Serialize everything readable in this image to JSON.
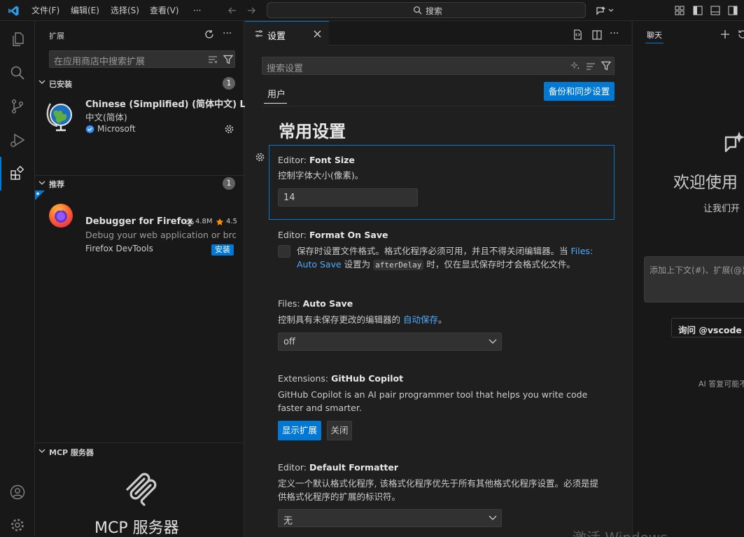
{
  "titlebar": {
    "menus": [
      "文件(F)",
      "编辑(E)",
      "选择(S)",
      "查看(V)",
      "···"
    ],
    "search_label": "搜索"
  },
  "sidebar": {
    "title": "扩展",
    "search_placeholder": "在应用商店中搜索扩展",
    "installed": {
      "header": "已安装",
      "count": "1",
      "items": [
        {
          "name": "Chinese (Simplified) (简体中文) L...",
          "desc": "中文(简体)",
          "publisher": "Microsoft"
        }
      ]
    },
    "recommended": {
      "header": "推荐",
      "count": "1",
      "items": [
        {
          "name": "Debugger for Firefox",
          "downloads": "4.8M",
          "rating": "4.5",
          "desc": "Debug your web application or bro...",
          "publisher": "Firefox DevTools",
          "install_label": "安装"
        }
      ]
    },
    "mcp": {
      "header": "MCP 服务器",
      "title": "MCP 服务器"
    }
  },
  "editor": {
    "tab_label": "设置",
    "search_placeholder": "搜索设置",
    "scope_tab": "用户",
    "backup_button": "备份和同步设置",
    "heading": "常用设置",
    "settings": {
      "font_size": {
        "category": "Editor: ",
        "name": "Font Size",
        "desc": "控制字体大小(像素)。",
        "value": "14"
      },
      "format_on_save": {
        "category": "Editor: ",
        "name": "Format On Save",
        "desc_a": "保存时设置文件格式。格式化程序必须可用，并且不得关闭编辑器。当 ",
        "link": "Files: Auto Save",
        "desc_b": " 设置为 ",
        "code": "afterDelay",
        "desc_c": " 时，仅在显式保存时才会格式化文件。"
      },
      "auto_save": {
        "category": "Files: ",
        "name": "Auto Save",
        "desc_a": "控制具有未保存更改的编辑器的 ",
        "link": "自动保存",
        "desc_b": "。",
        "value": "off"
      },
      "copilot": {
        "category": "Extensions: ",
        "name": "GitHub Copilot",
        "desc": "GitHub Copilot is an AI pair programmer tool that helps you write code faster and smarter.",
        "show_button": "显示扩展",
        "close_button": "关闭"
      },
      "default_formatter": {
        "category": "Editor: ",
        "name": "Default Formatter",
        "desc": "定义一个默认格式化程序, 该格式化程序优先于所有其他格式化程序设置。必须是提供格式化程序的扩展的标识符。",
        "value": "无"
      }
    }
  },
  "chat": {
    "tab_label": "聊天",
    "welcome": "欢迎使用",
    "subtitle": "让我们开",
    "input_placeholder": "添加上下文(#)、扩展(@)",
    "ask_button": "询问 @vscode",
    "footer": "AI 答复可能不"
  },
  "watermark": "激活 Windows",
  "colors": {
    "accent": "#0078d4",
    "link": "#4daafc"
  }
}
